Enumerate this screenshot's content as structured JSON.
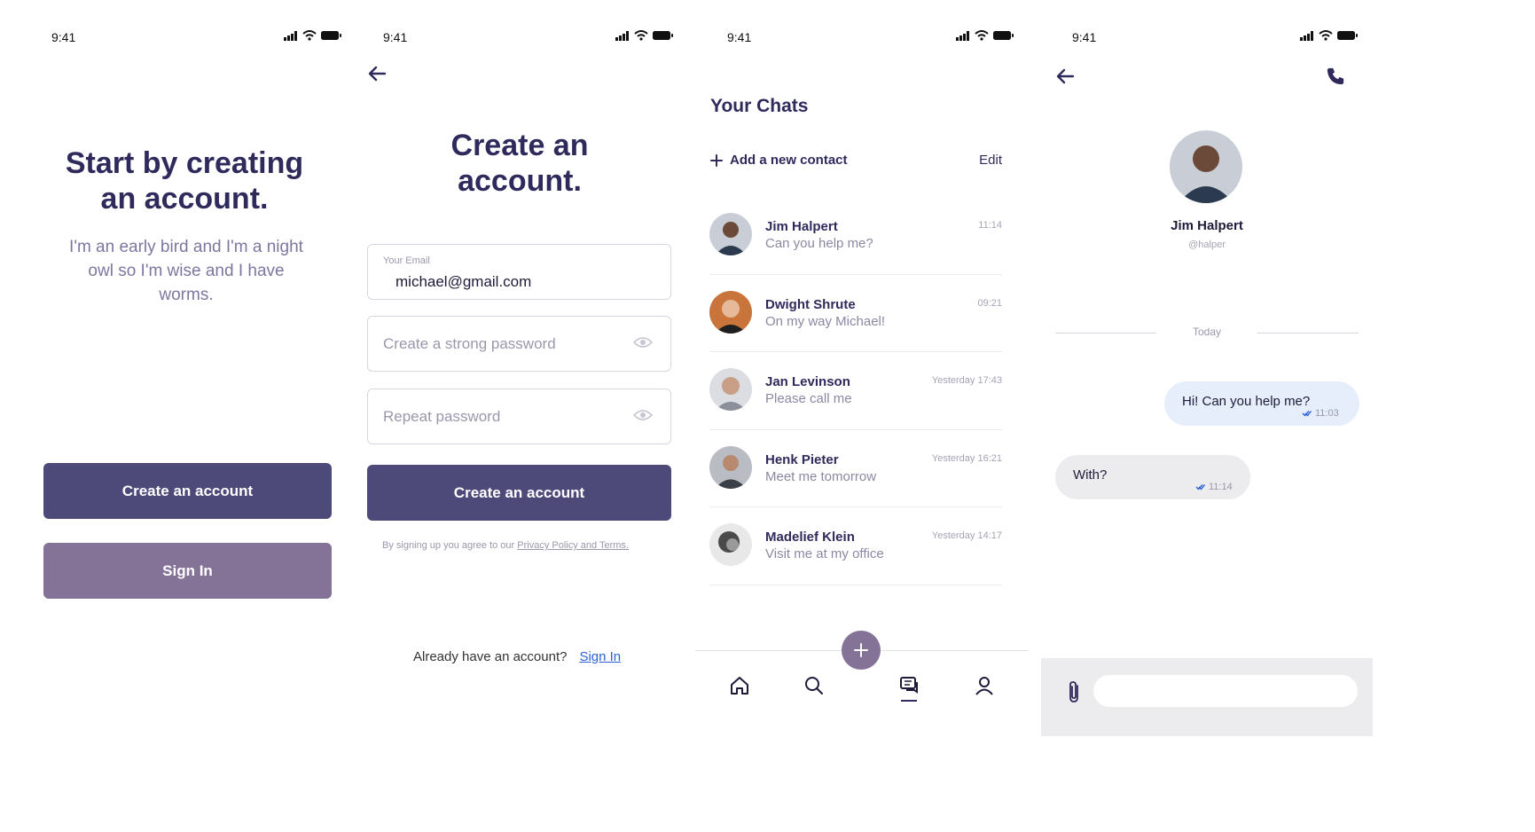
{
  "status_time": "9:41",
  "welcome": {
    "title_line1": "Start by creating",
    "title_line2": "an account.",
    "subtitle_line1": "I'm an early bird and I'm a night",
    "subtitle_line2": "owl so I'm wise and I have",
    "subtitle_line3": "worms.",
    "primary_button": "Create an account",
    "secondary_button": "Sign In"
  },
  "signup": {
    "title_line1": "Create an",
    "title_line2": "account.",
    "email_label": "Your Email",
    "email_value": "michael@gmail.com",
    "password_placeholder": "Create a strong password",
    "repeat_placeholder": "Repeat password",
    "submit_button": "Create an account",
    "terms_prefix": "By signing up you agree to our ",
    "terms_link": "Privacy Policy and Terms.",
    "already_text": "Already have an account?",
    "sign_in_link": "Sign In"
  },
  "chats": {
    "title": "Your Chats",
    "add_contact": "Add a new contact",
    "edit": "Edit",
    "items": [
      {
        "name": "Jim Halpert",
        "message": "Can you help me?",
        "time": "11:14"
      },
      {
        "name": "Dwight Shrute",
        "message": "On my way Michael!",
        "time": "09:21"
      },
      {
        "name": "Jan Levinson",
        "message": "Please call me",
        "time": "Yesterday 17:43"
      },
      {
        "name": "Henk Pieter",
        "message": "Meet me tomorrow",
        "time": "Yesterday 16:21"
      },
      {
        "name": "Madelief Klein",
        "message": "Visit me at my office",
        "time": "Yesterday 14:17"
      }
    ],
    "nav": [
      "home-icon",
      "search-icon",
      "chat-icon",
      "profile-icon"
    ]
  },
  "conversation": {
    "contact_name": "Jim Halpert",
    "contact_handle": "@halper",
    "day_label": "Today",
    "messages": [
      {
        "direction": "out",
        "text": "Hi! Can you help me?",
        "time": "11:03"
      },
      {
        "direction": "in",
        "text": "With?",
        "time": "11:14"
      }
    ],
    "input_placeholder": ""
  },
  "colors": {
    "primary": "#4d4979",
    "secondary": "#857397",
    "heading": "#2f2a5c",
    "bubble_out": "#e6eefb",
    "bubble_in": "#ececee"
  }
}
